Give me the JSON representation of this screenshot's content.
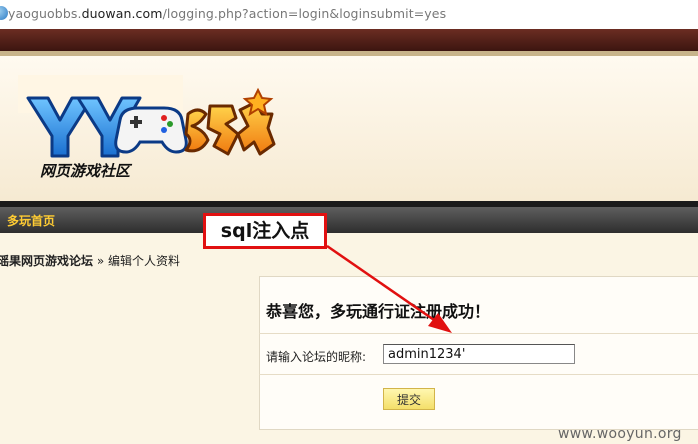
{
  "browser": {
    "url_host_prefix": "yaoguobbs.",
    "url_host": "duowan.com",
    "url_path": "/logging.php?action=login&loginsubmit=yes"
  },
  "logo": {
    "brand": "YY游戏",
    "tagline": "网页游戏社区"
  },
  "nav": {
    "items": [
      {
        "label": "多玩首页"
      }
    ]
  },
  "breadcrumb": {
    "forum": "瑶果网页游戏论坛",
    "separator": "»",
    "current": "编辑个人资料"
  },
  "form": {
    "success_message": "恭喜您，多玩通行证注册成功！",
    "nickname_label": "请输入论坛的昵称:",
    "nickname_value": "admin1234'",
    "submit_label": "提交"
  },
  "annotation": {
    "callout_text": "sql注入点",
    "color": "#e11010"
  },
  "watermark": "www.wooyun.org"
}
